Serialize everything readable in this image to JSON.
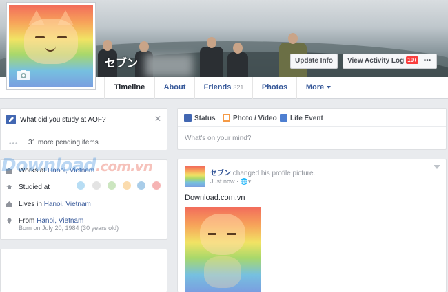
{
  "profile": {
    "name": "セブン"
  },
  "cover_buttons": {
    "update_info": "Update Info",
    "activity_log": "View Activity Log",
    "activity_badge": "10+",
    "more": "•••"
  },
  "tabs": [
    {
      "label": "Timeline",
      "active": true
    },
    {
      "label": "About"
    },
    {
      "label": "Friends",
      "count": "321"
    },
    {
      "label": "Photos"
    },
    {
      "label": "More"
    }
  ],
  "question": {
    "text": "What did you study at AOF?",
    "pending": "31 more pending items"
  },
  "about": {
    "work": {
      "prefix": "Works at ",
      "place": "Hanoi, Vietnam"
    },
    "studied": {
      "label": "Studied at"
    },
    "lives": {
      "prefix": "Lives in ",
      "place": "Hanoi, Vietnam"
    },
    "from": {
      "prefix": "From ",
      "place": "Hanoi, Vietnam",
      "born": "Born on July 20, 1984 (30 years old)"
    },
    "school_colors": [
      "#b7ddf4",
      "#e3e3e3",
      "#cce6c0",
      "#fbdcae",
      "#a9cde9",
      "#f6b4b4"
    ]
  },
  "composer": {
    "status": "Status",
    "photo_video": "Photo / Video",
    "life_event": "Life Event",
    "placeholder": "What's on your mind?"
  },
  "post": {
    "author": "セブン",
    "action": "changed his profile picture.",
    "time": "Just now · ",
    "privacy_glyph": "🌐▾",
    "text": "Download.com.vn"
  },
  "watermark": {
    "main": "Download",
    "domain": ".com.vn"
  }
}
